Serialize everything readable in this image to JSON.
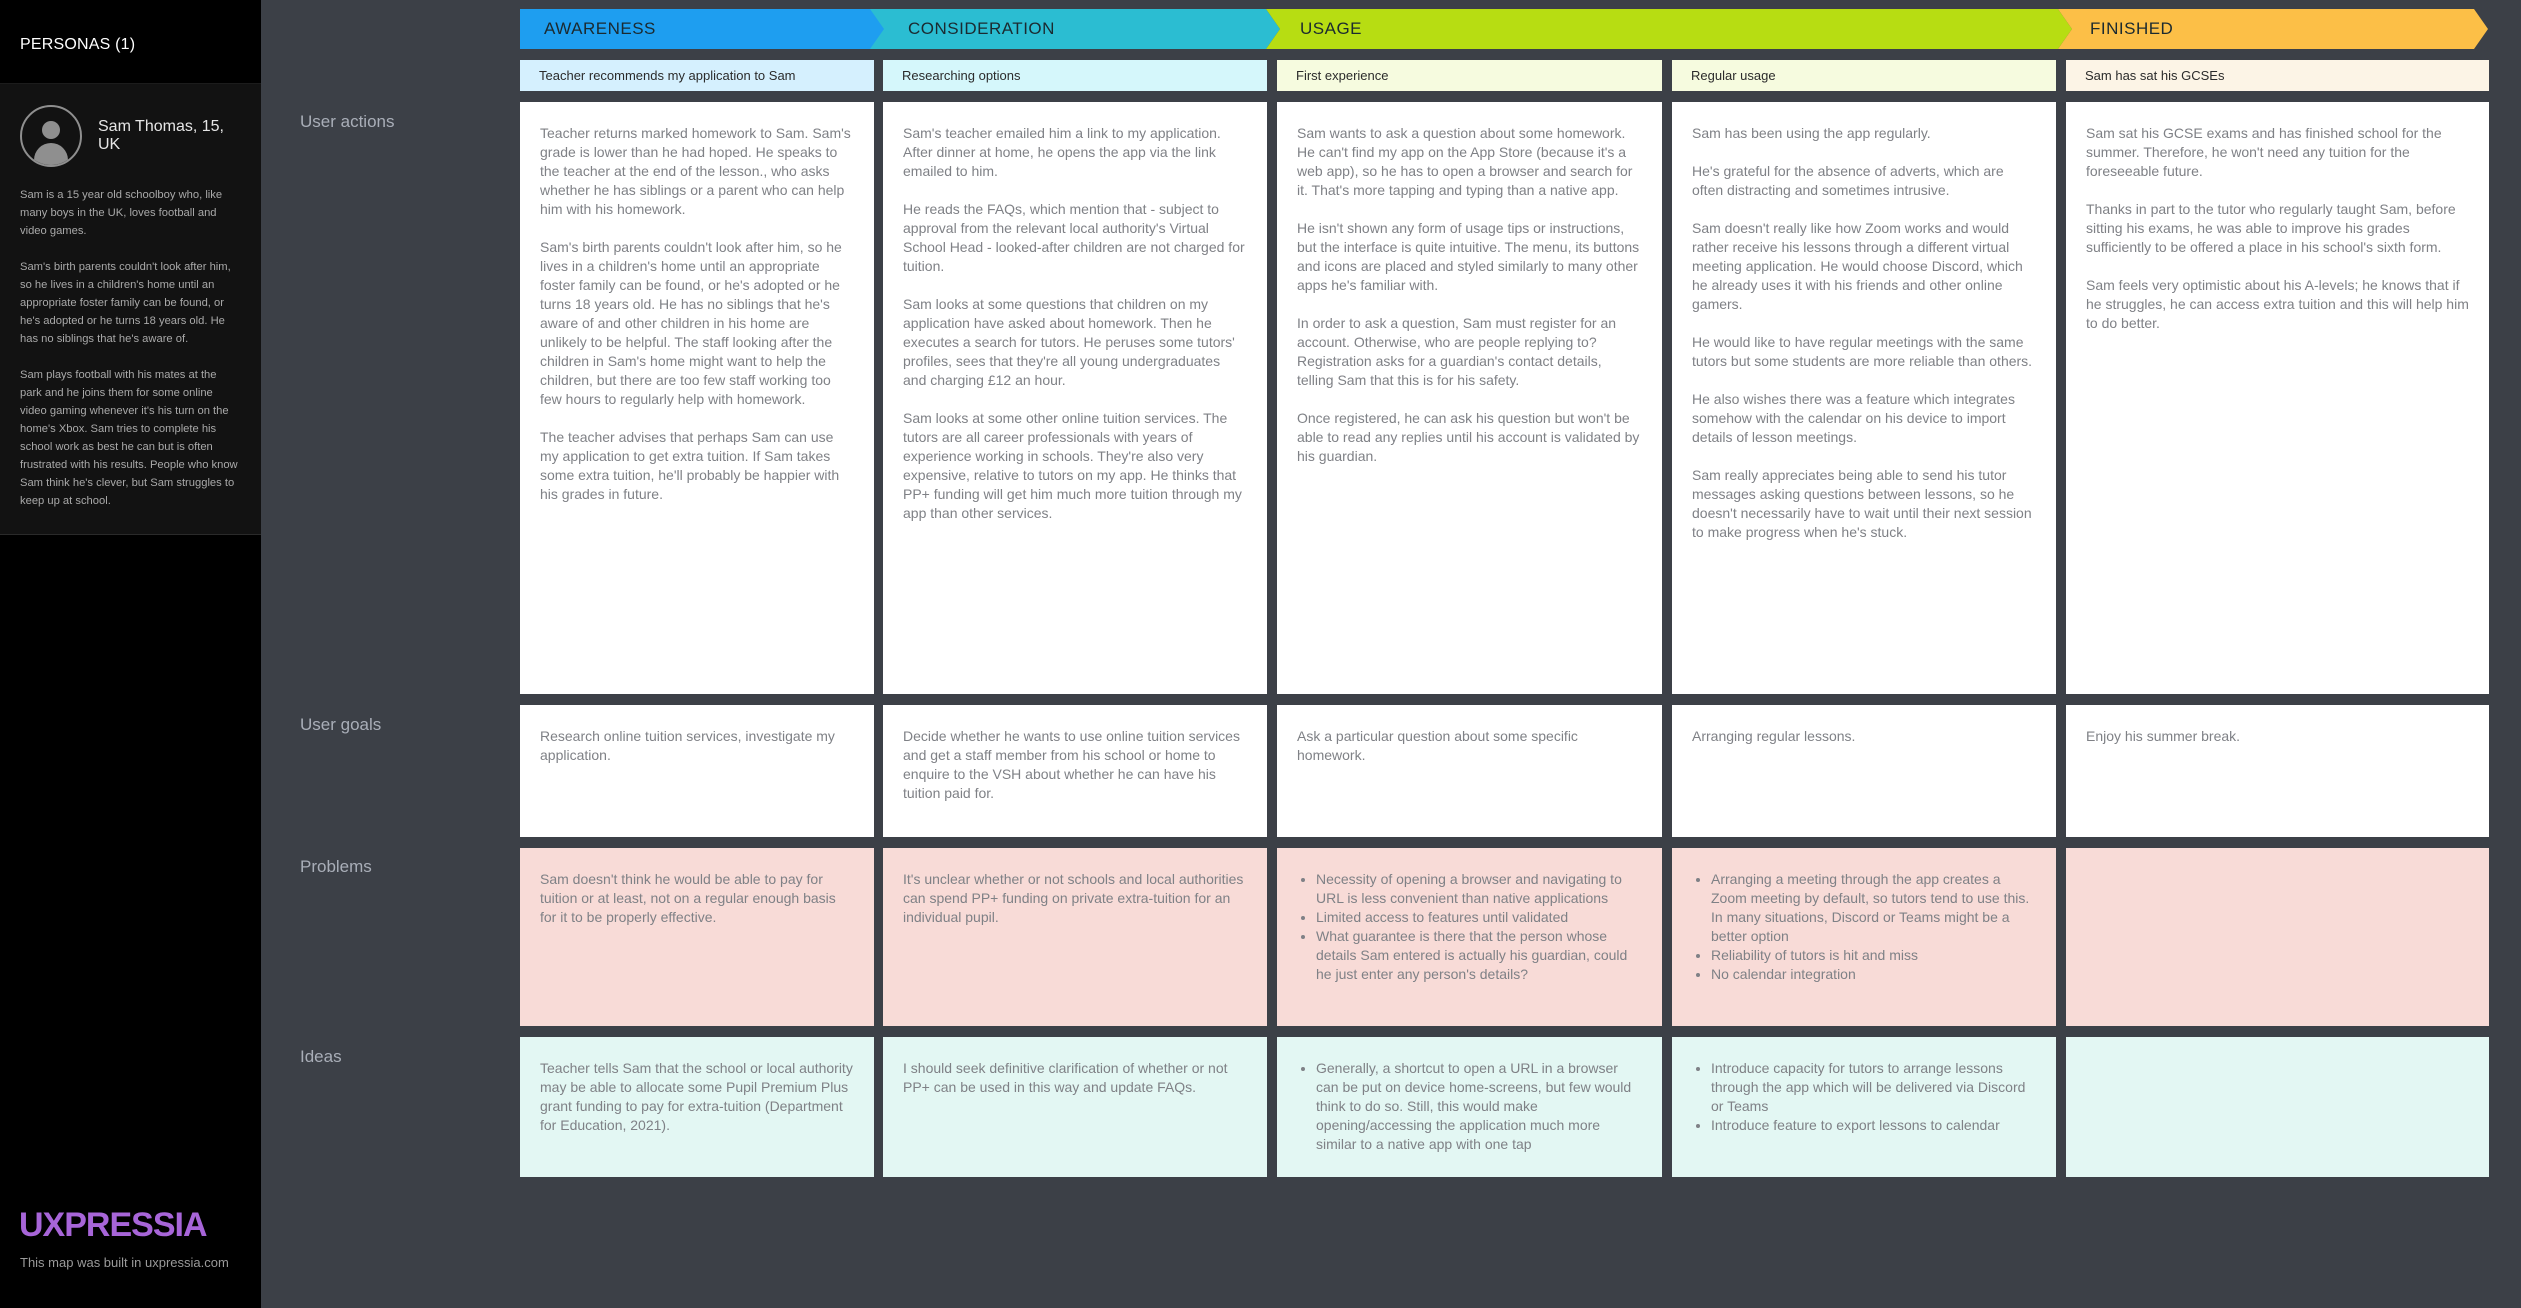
{
  "sidebar": {
    "header": "PERSONAS (1)",
    "persona": {
      "name": "Sam Thomas, 15, UK",
      "bio": [
        "Sam is a 15 year old schoolboy who, like many boys in the UK, loves football and video games.",
        "Sam's birth parents couldn't look after him, so he lives in a children's home until an appropriate foster family can be found, or he's adopted or he turns 18 years old. He has no siblings that he's aware of.",
        "Sam plays football with his mates at the park and he joins them for some online video gaming whenever it's his turn on the home's Xbox. Sam tries to complete his school work as best he can but is often frustrated with his results. People who know Sam think he's clever, but Sam struggles to keep up at school."
      ]
    },
    "brand": "UXPRESSIA",
    "built_note": "This map was built in uxpressia.com"
  },
  "row_labels": {
    "actions": "User actions",
    "goals": "User goals",
    "problems": "Problems",
    "ideas": "Ideas"
  },
  "colors": {
    "awareness": "#1e9ef0",
    "consideration": "#2bbdd2",
    "usage": "#b7dd12",
    "finished": "#fcbf47"
  },
  "stages": [
    {
      "label": "AWARENESS"
    },
    {
      "label": "CONSIDERATION"
    },
    {
      "label": "USAGE"
    },
    {
      "label": "FINISHED"
    }
  ],
  "steps": [
    "Teacher recommends my application to Sam",
    "Researching options",
    "First experience",
    "Regular usage",
    "Sam has sat his GCSEs"
  ],
  "actions": [
    [
      "Teacher returns marked homework to Sam. Sam's grade is lower than he had hoped. He speaks to the teacher at the end of the lesson., who asks whether he has siblings or a parent who can help him with his homework.",
      "Sam's birth parents couldn't look after him, so he lives in a children's home until an appropriate foster family can be found, or he's adopted or he turns 18 years old. He has no siblings that he's aware of and other children in his home are unlikely to be helpful. The staff looking after the children in Sam's home might want to help the children, but there are too few staff working too few hours to regularly help with homework.",
      "The teacher advises that perhaps Sam can use my application to get extra tuition. If Sam takes some extra tuition, he'll probably be happier with his grades in future."
    ],
    [
      "Sam's teacher emailed him a link to my application. After dinner at home, he opens the app via the link emailed to him.",
      "He reads the FAQs, which mention that - subject to approval from the relevant local authority's Virtual School Head - looked-after children are not charged for tuition.",
      "Sam looks at some questions that children on my application have asked about homework. Then he executes a search for tutors. He peruses some tutors' profiles, sees that they're all young undergraduates and charging £12 an hour.",
      "Sam looks at some other online tuition services. The tutors are all career professionals with years of experience working in schools. They're also very expensive, relative to tutors on my app. He thinks that PP+ funding will get him much more tuition through my app than other services."
    ],
    [
      "Sam wants to ask a question about some homework. He can't find my app on the App Store (because it's a web app), so he has to open a browser and search for it. That's more tapping and typing than a native app.",
      "He isn't shown any form of usage tips or instructions, but the interface is quite intuitive. The menu, its buttons and icons are placed and styled similarly to many other apps he's familiar with.",
      "In order to ask a question, Sam must register for an account. Otherwise, who are people replying to? Registration asks for a guardian's contact details, telling Sam that this is for his safety.",
      "Once registered, he can ask his question but won't be able to read any replies until his account is validated by his guardian."
    ],
    [
      "Sam has been using the app regularly.",
      "He's grateful for the absence of adverts, which are often distracting and sometimes intrusive.",
      "Sam doesn't really like how Zoom works and would rather receive his lessons through a different virtual meeting application. He would choose Discord, which he already uses it with his friends and other online gamers.",
      "He would like to have regular meetings with the same tutors but some students are more reliable than others.",
      "He also wishes there was a feature which integrates somehow with the calendar on his device to import details of lesson meetings.",
      "Sam really appreciates being able to send his tutor messages asking questions between lessons, so he doesn't necessarily have to wait until their next session to make progress when he's stuck."
    ],
    [
      "Sam sat his GCSE exams and has finished school for the summer. Therefore, he won't need any tuition for the foreseeable future.",
      "Thanks in part to the tutor who regularly taught Sam, before sitting his exams, he was able to improve his grades sufficiently to be offered a place in his school's sixth form.",
      "Sam feels very optimistic about his A-levels; he knows that if he struggles, he can access extra tuition and this will help him to do better."
    ]
  ],
  "goals": [
    "Research online tuition services, investigate my application.",
    "Decide whether he wants to use online tuition services and get a staff member from his school or home to enquire to the VSH about whether he can have his tuition paid for.",
    "Ask a particular question about some specific homework.",
    "Arranging regular lessons.",
    "Enjoy his summer break."
  ],
  "problems": {
    "c0": "Sam doesn't think he would be able to pay for tuition or at least, not on a regular enough basis for it to be properly effective.",
    "c1": "It's unclear whether or not schools and local authorities can spend PP+ funding on private extra-tuition for an individual pupil.",
    "c2": [
      "Necessity of opening a browser and navigating to URL is less convenient than native applications",
      "Limited access to features until validated",
      "What guarantee is there that the person whose details Sam entered is actually his guardian, could he just enter any person's details?"
    ],
    "c3": [
      "Arranging a meeting through the app creates a Zoom meeting by default, so tutors tend to use this. In many situations, Discord or Teams might be a better option",
      "Reliability of tutors is hit and miss",
      "No calendar integration"
    ]
  },
  "ideas": {
    "c0": "Teacher tells Sam that the school or local authority may be able to allocate some Pupil Premium Plus grant funding to pay for extra-tuition (Department for Education, 2021).",
    "c1": "I should seek definitive clarification of whether or not PP+ can be used in this way and update FAQs.",
    "c2": [
      "Generally, a shortcut to open a URL in a browser can be put on device home-screens, but few would think to do so. Still, this would make opening/accessing the application much more similar to a native app with one tap"
    ],
    "c3": [
      "Introduce capacity for tutors to arrange lessons through the app which will be delivered via Discord or Teams",
      "Introduce feature to export lessons to calendar"
    ]
  }
}
